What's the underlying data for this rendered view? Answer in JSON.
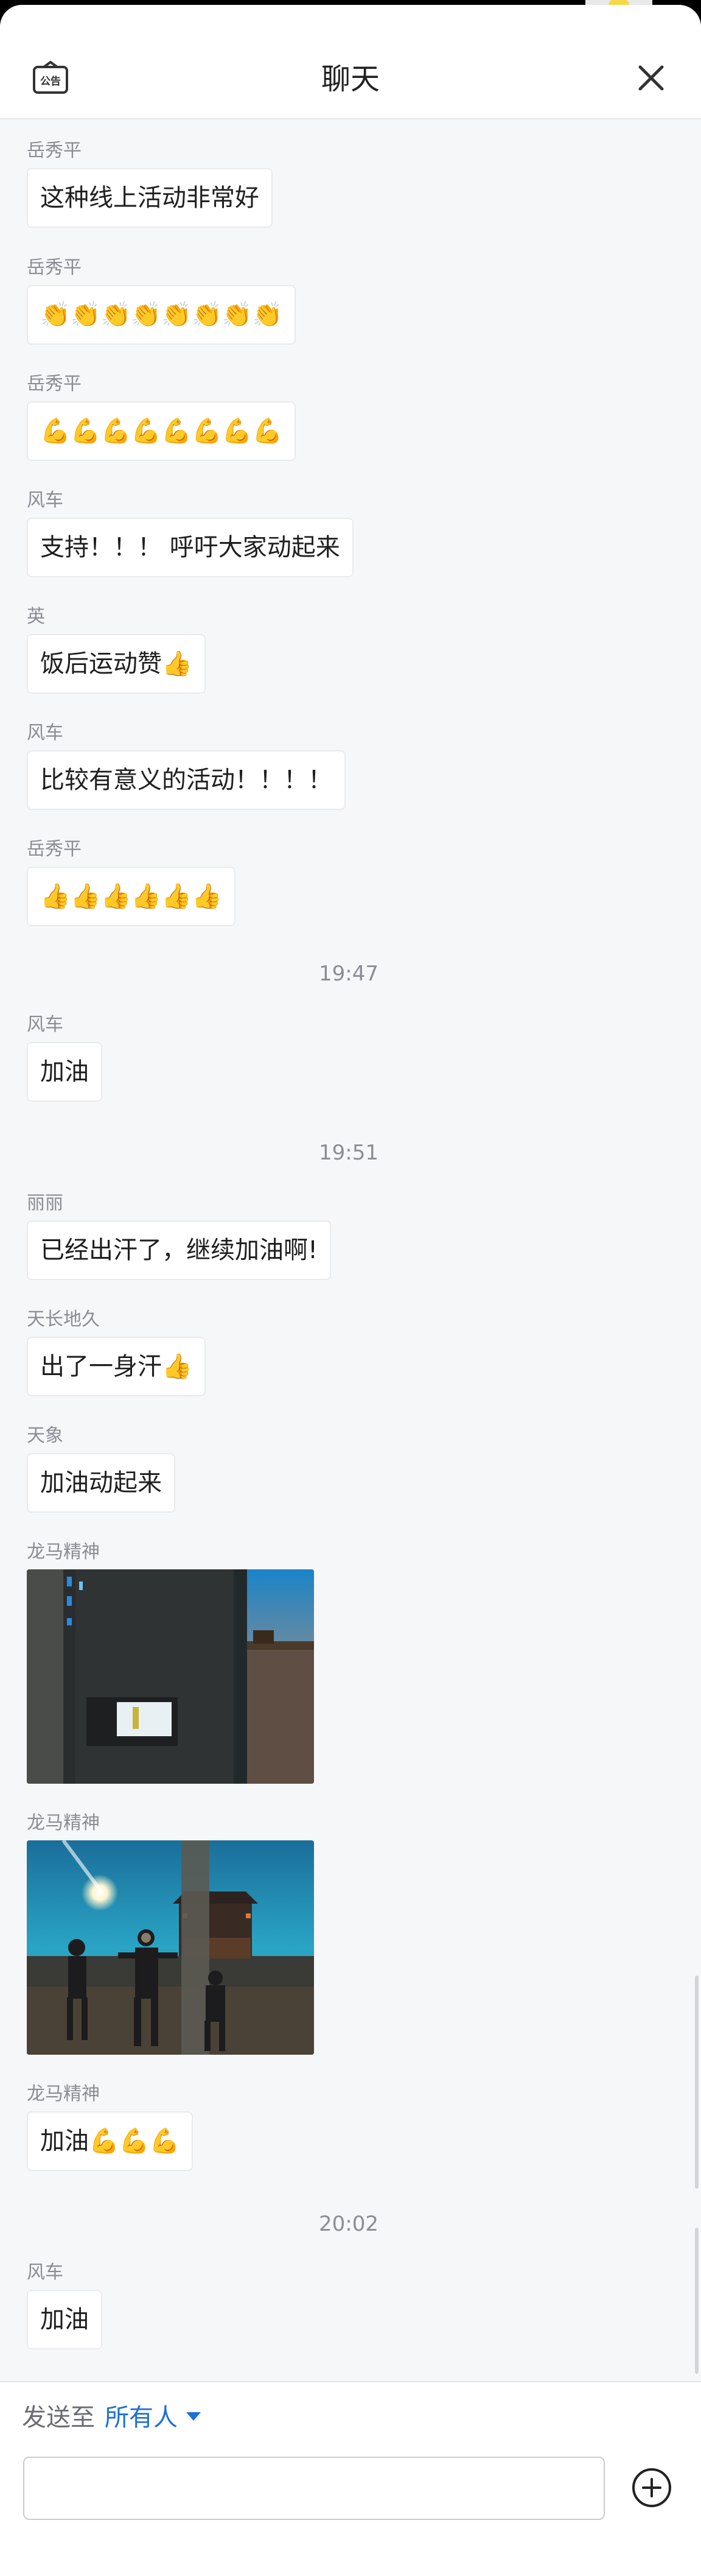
{
  "header": {
    "title": "聊天",
    "notice_label": "公告"
  },
  "messages": [
    {
      "sender": "岳秀平",
      "text": "这种线上活动非常好"
    },
    {
      "sender": "岳秀平",
      "text": "👏👏👏👏👏👏👏👏"
    },
    {
      "sender": "岳秀平",
      "text": "💪💪💪💪💪💪💪💪"
    },
    {
      "sender": "风车",
      "text": "支持！！！ 呼吁大家动起来"
    },
    {
      "sender": "英",
      "text": "饭后运动赞👍"
    },
    {
      "sender": "风车",
      "text": "比较有意义的活动！！！！"
    },
    {
      "sender": "岳秀平",
      "text": "👍👍👍👍👍👍"
    },
    {
      "time": "19:47"
    },
    {
      "sender": "风车",
      "text": "加油"
    },
    {
      "time": "19:51"
    },
    {
      "sender": "丽丽",
      "text": "已经出汗了，继续加油啊!"
    },
    {
      "sender": "天长地久",
      "text": "出了一身汗👍"
    },
    {
      "sender": "天象",
      "text": "加油动起来"
    },
    {
      "sender": "龙马精神",
      "image": "night-exercise-screen-photo"
    },
    {
      "sender": "龙马精神",
      "image": "night-group-exercise-photo"
    },
    {
      "sender": "龙马精神",
      "text": "加油💪💪💪"
    },
    {
      "time": "20:02"
    },
    {
      "sender": "风车",
      "text": "加油"
    }
  ],
  "footer": {
    "send_to_label": "发送至",
    "target": "所有人",
    "input_value": "",
    "add_icon": "plus-circle-icon"
  },
  "colors": {
    "accent": "#1e6fd9",
    "background": "#f6f7f9"
  }
}
